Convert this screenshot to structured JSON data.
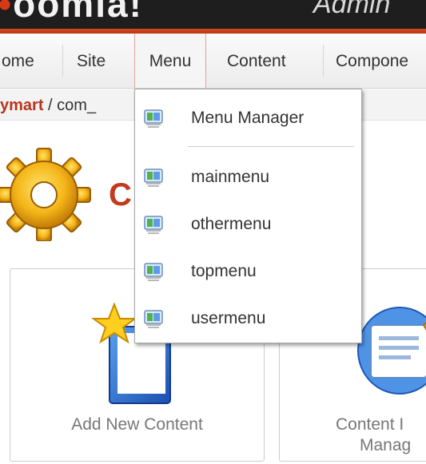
{
  "header": {
    "logo_text": "oomla!",
    "logo_dot": "•",
    "subtitle": "Admin"
  },
  "menubar": {
    "items": [
      {
        "label": "ome"
      },
      {
        "label": "Site"
      },
      {
        "label": "Menu"
      },
      {
        "label": "Content"
      },
      {
        "label": "Compone"
      }
    ]
  },
  "breadcrumb": {
    "link": "ymart",
    "separator": " / ",
    "text": "com_"
  },
  "cpanel": {
    "title": "C",
    "panels": [
      {
        "label": "Add New Content"
      },
      {
        "label": "Content I",
        "label2": "Manag"
      }
    ]
  },
  "dropdown": {
    "items": [
      {
        "label": "Menu Manager"
      },
      {
        "label": "mainmenu"
      },
      {
        "label": "othermenu"
      },
      {
        "label": "topmenu"
      },
      {
        "label": "usermenu"
      }
    ]
  }
}
